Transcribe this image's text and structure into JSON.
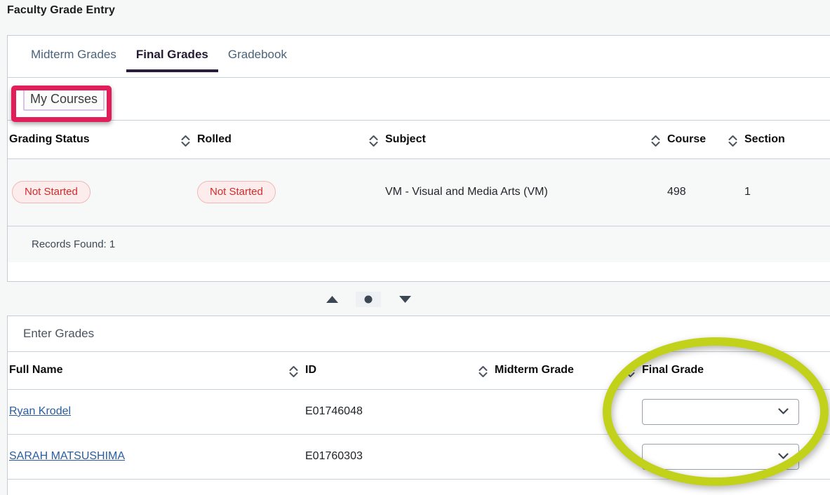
{
  "page": {
    "title": "Faculty Grade Entry"
  },
  "tabs": [
    {
      "label": "Midterm Grades",
      "active": false
    },
    {
      "label": "Final Grades",
      "active": true
    },
    {
      "label": "Gradebook",
      "active": false
    }
  ],
  "toolbar": {
    "my_courses_label": "My Courses"
  },
  "course_table": {
    "columns": [
      "Grading Status",
      "Rolled",
      "Subject",
      "Course",
      "Section"
    ],
    "rows": [
      {
        "grading_status": "Not Started",
        "rolled": "Not Started",
        "subject": "VM - Visual and Media Arts (VM)",
        "course": "498",
        "section": "1"
      }
    ],
    "records_found": "Records Found: 1"
  },
  "carousel": {
    "up_icon": "triangle-up-icon",
    "dot_icon": "dot-icon",
    "down_icon": "triangle-down-icon"
  },
  "grades_panel": {
    "heading": "Enter Grades",
    "columns": [
      "Full Name",
      "ID",
      "Midterm Grade",
      "Final Grade"
    ],
    "rows": [
      {
        "full_name": "Ryan Krodel",
        "id": "E01746048",
        "midterm_grade": "",
        "final_grade": ""
      },
      {
        "full_name": "SARAH MATSUSHIMA",
        "id": "E01760303",
        "midterm_grade": "",
        "final_grade": ""
      }
    ]
  },
  "icons": {
    "sort": "sort-icon",
    "dropdown_chevron": "chevron-down-icon"
  },
  "colors": {
    "active_tab_underline": "#2b1b3d",
    "link": "#2a5d9e",
    "badge_text": "#d32b2b",
    "badge_bg": "#fdecec",
    "annotation_rect": "#e01e5a",
    "annotation_ellipse": "#c2d21a",
    "my_courses_border": "#d9c4e8"
  }
}
